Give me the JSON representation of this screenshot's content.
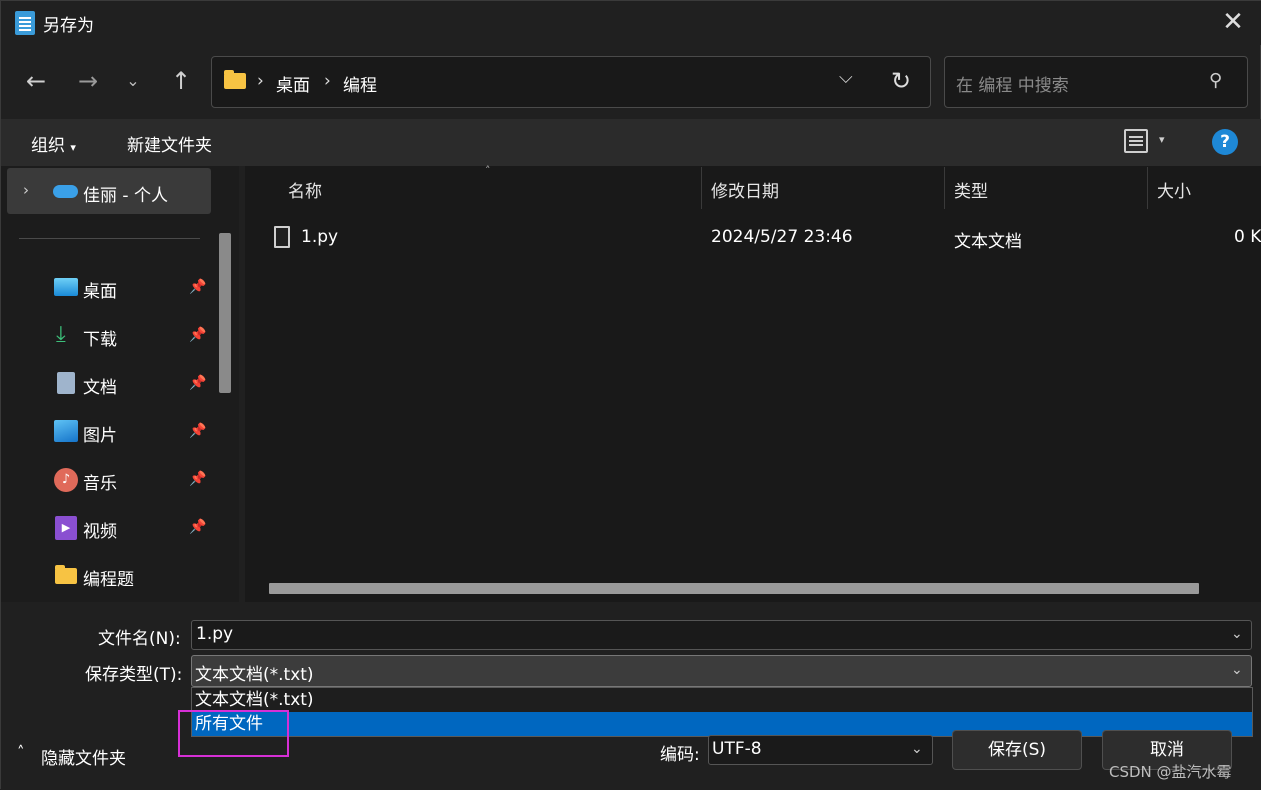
{
  "window": {
    "title": "另存为"
  },
  "nav": {
    "back_icon": "arrow-left-icon",
    "forward_icon": "arrow-right-icon",
    "recent_icon": "chevron-down-icon",
    "up_icon": "arrow-up-icon"
  },
  "address": {
    "crumbs": [
      "桌面",
      "编程"
    ]
  },
  "search": {
    "placeholder": "在 编程 中搜索"
  },
  "toolbar": {
    "organize": "组织",
    "new_folder": "新建文件夹"
  },
  "sidebar": {
    "cloud": "佳丽 - 个人",
    "items": [
      {
        "label": "桌面",
        "icon": "desktop-icon",
        "pinned": true
      },
      {
        "label": "下载",
        "icon": "download-icon",
        "pinned": true
      },
      {
        "label": "文档",
        "icon": "document-icon",
        "pinned": true
      },
      {
        "label": "图片",
        "icon": "picture-icon",
        "pinned": true
      },
      {
        "label": "音乐",
        "icon": "music-icon",
        "pinned": true
      },
      {
        "label": "视频",
        "icon": "video-icon",
        "pinned": true
      },
      {
        "label": "编程题",
        "icon": "folder-icon",
        "pinned": false
      }
    ]
  },
  "columns": [
    "名称",
    "修改日期",
    "类型",
    "大小"
  ],
  "files": [
    {
      "name": "1.py",
      "date": "2024/5/27 23:46",
      "type": "文本文档",
      "size": "0 K"
    }
  ],
  "form": {
    "filename_label": "文件名(N):",
    "filename_value": "1.py",
    "filetype_label": "保存类型(T):",
    "filetype_value": "文本文档(*.txt)",
    "options": [
      "文本文档(*.txt)",
      "所有文件"
    ],
    "hide_folders": "隐藏文件夹",
    "encoding_label": "编码:",
    "encoding_value": "UTF-8",
    "save": "保存(S)",
    "cancel": "取消"
  },
  "watermark": "CSDN @盐汽水霉",
  "colors": {
    "accent": "#0067c0",
    "highlight_box": "#d62fd6"
  }
}
